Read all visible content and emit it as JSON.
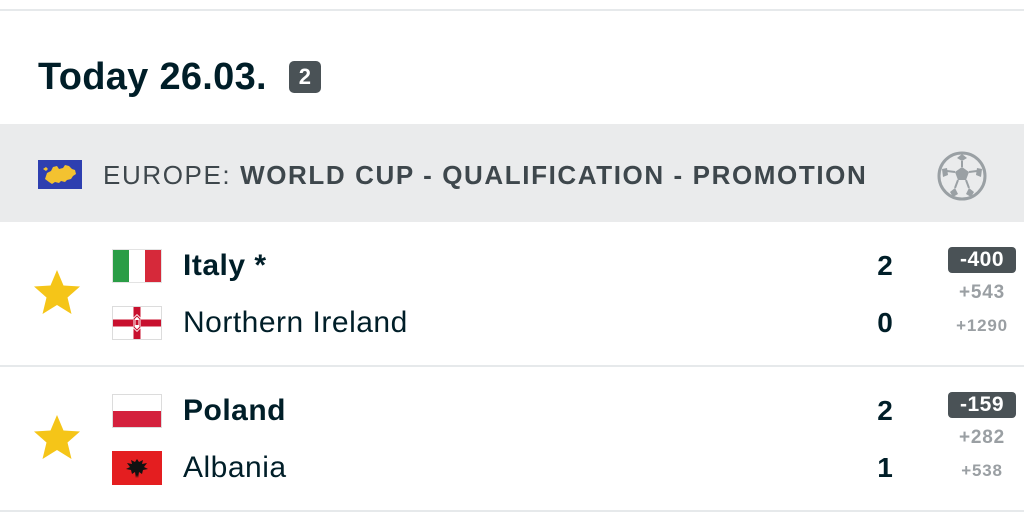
{
  "day": {
    "title": "Today 26.03.",
    "count": "2"
  },
  "league": {
    "country": "EUROPE: ",
    "name": "WORLD CUP - QUALIFICATION - PROMOTION",
    "flag_icon": "europe-flag-icon",
    "sport_icon": "soccer-ball-icon"
  },
  "matches": [
    {
      "home": {
        "name": "Italy *",
        "flag_icon": "italy-flag-icon",
        "winner": true
      },
      "away": {
        "name": "Northern Ireland",
        "flag_icon": "northern-ireland-flag-icon",
        "winner": false
      },
      "score": {
        "home": "2",
        "away": "0"
      },
      "odds": {
        "one": "-400",
        "x": "+543",
        "two": "+1290"
      }
    },
    {
      "home": {
        "name": "Poland",
        "flag_icon": "poland-flag-icon",
        "winner": true
      },
      "away": {
        "name": "Albania",
        "flag_icon": "albania-flag-icon",
        "winner": false
      },
      "score": {
        "home": "2",
        "away": "1"
      },
      "odds": {
        "one": "-159",
        "x": "+282",
        "two": "+538"
      }
    }
  ],
  "colors": {
    "text": "#001e28",
    "league_bar": "#eaebec",
    "badge": "#4a5256",
    "star": "#f5c518",
    "muted": "#9a9fa3"
  }
}
